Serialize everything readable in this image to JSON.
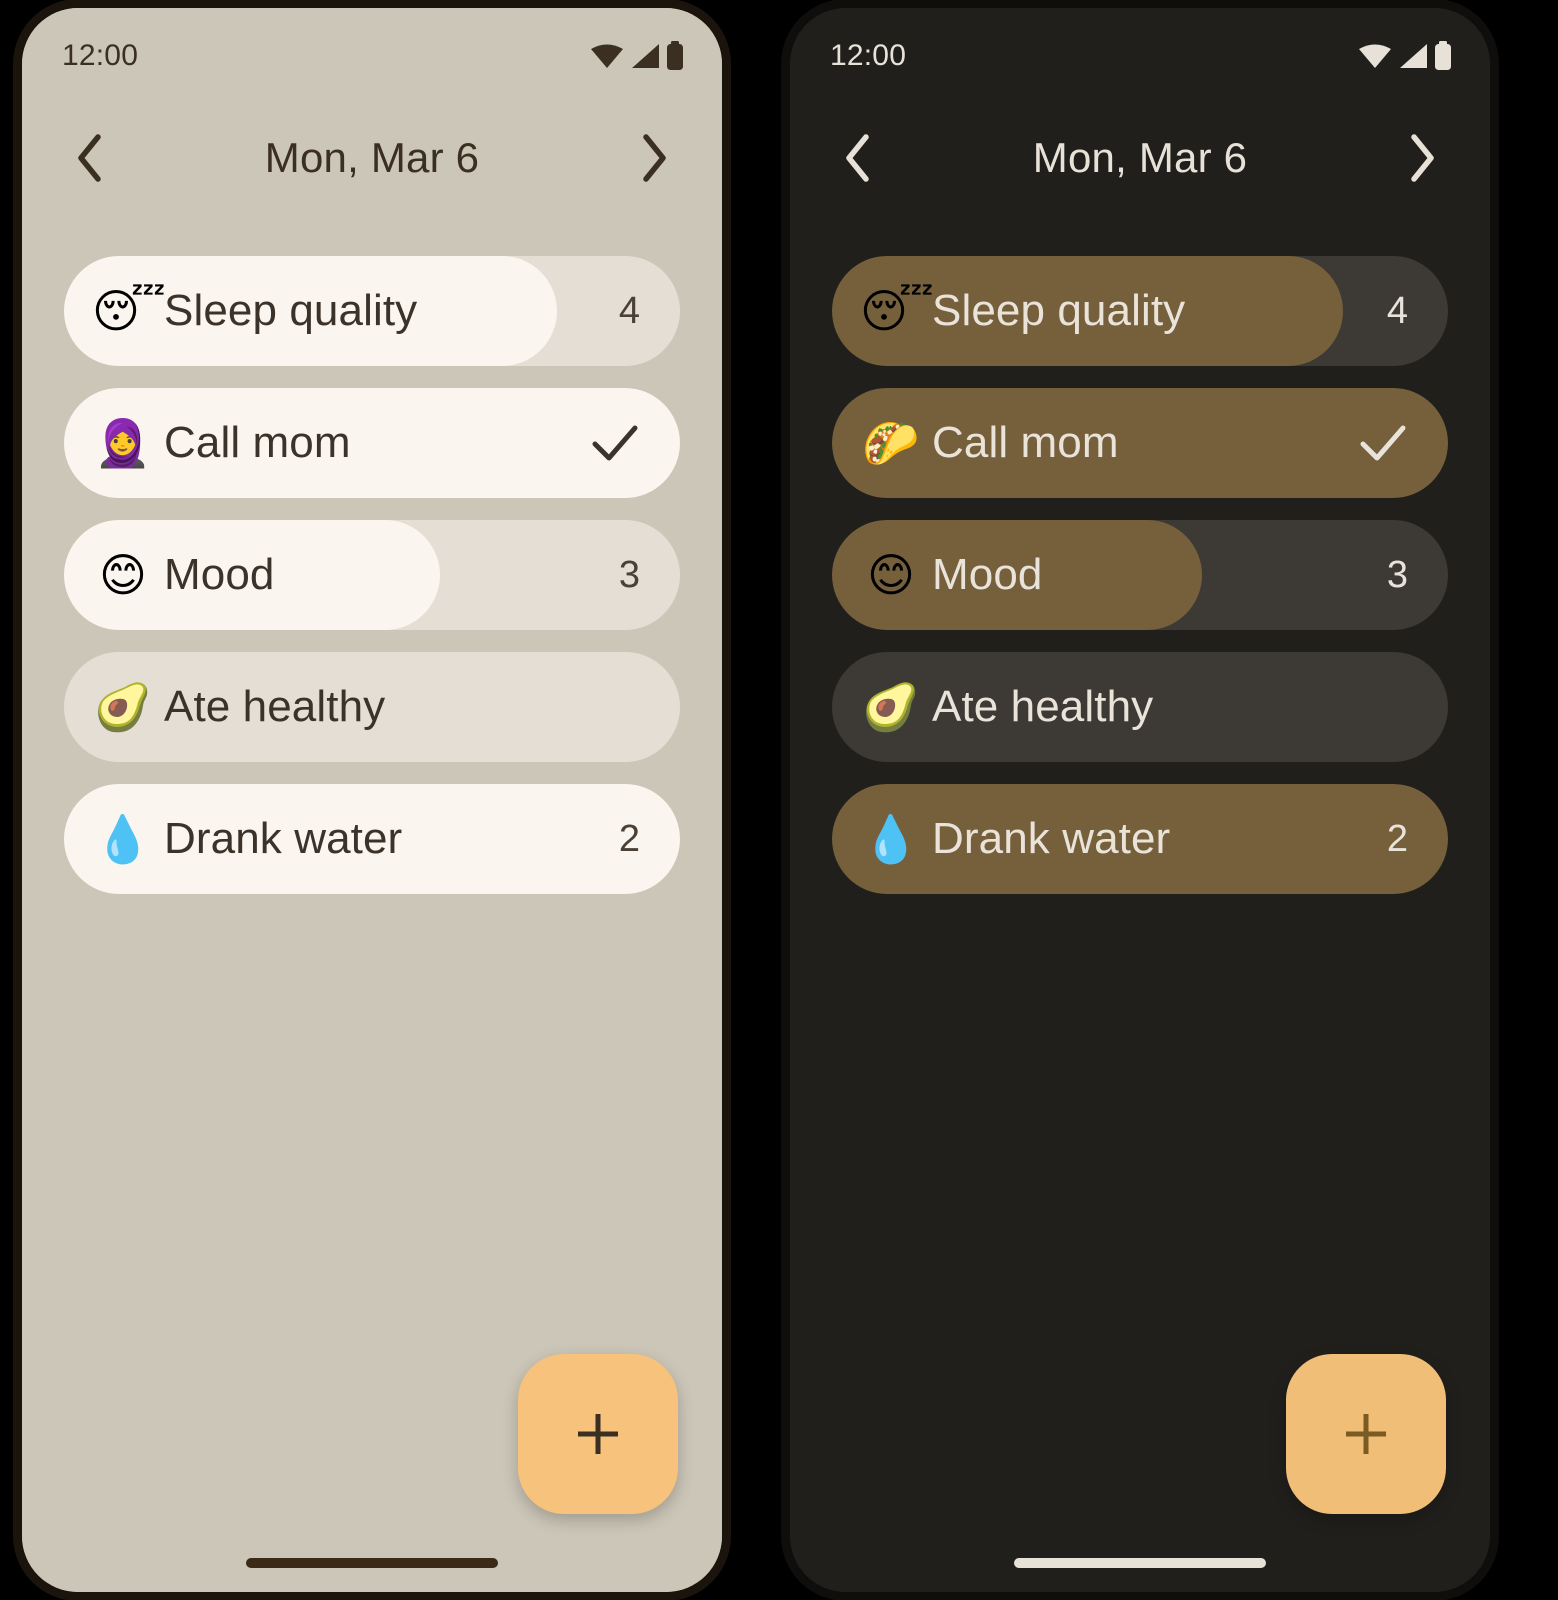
{
  "screens": [
    {
      "theme": "light",
      "name": "light-theme-phone",
      "status": {
        "time": "12:00",
        "icons": [
          "wifi-icon",
          "cellular-signal-icon",
          "battery-icon"
        ]
      },
      "nav": {
        "prev_label": "‹",
        "prev_name": "previous-day-button",
        "title": "Mon, Mar 6",
        "next_label": "›",
        "next_name": "next-day-button"
      },
      "habits": [
        {
          "emoji": "😴",
          "emoji_name": "sleeping-face-emoji",
          "label": "Sleep quality",
          "value": "4",
          "type": "counter",
          "fill_pct": 80
        },
        {
          "emoji": "🧕",
          "emoji_name": "woman-with-headscarf-emoji",
          "label": "Call mom",
          "value": "",
          "type": "check",
          "fill_pct": 100
        },
        {
          "emoji": "😊",
          "emoji_name": "smiling-face-emoji",
          "label": "Mood",
          "value": "3",
          "type": "counter",
          "fill_pct": 61
        },
        {
          "emoji": "🥑",
          "emoji_name": "avocado-emoji",
          "label": "Ate healthy",
          "value": "",
          "type": "none",
          "fill_pct": 0
        },
        {
          "emoji": "💧",
          "emoji_name": "droplet-emoji",
          "label": "Drank water",
          "value": "2",
          "type": "counter",
          "fill_pct": 100
        }
      ],
      "fab": {
        "label": "+",
        "name": "add-habit-button"
      },
      "colors": {
        "background": "#CCC6B8",
        "track": "#E5DED4",
        "fill": "#FAF5EF",
        "text": "#3B332A",
        "accent": "#F6C27C"
      }
    },
    {
      "theme": "dark",
      "name": "dark-theme-phone",
      "status": {
        "time": "12:00",
        "icons": [
          "wifi-icon",
          "cellular-signal-icon",
          "battery-icon"
        ]
      },
      "nav": {
        "prev_label": "‹",
        "prev_name": "previous-day-button",
        "title": "Mon, Mar 6",
        "next_label": "›",
        "next_name": "next-day-button"
      },
      "habits": [
        {
          "emoji": "😴",
          "emoji_name": "sleeping-face-emoji",
          "label": "Sleep quality",
          "value": "4",
          "type": "counter",
          "fill_pct": 83
        },
        {
          "emoji": "🌮",
          "emoji_name": "taco-emoji",
          "label": "Call mom",
          "value": "",
          "type": "check",
          "fill_pct": 100
        },
        {
          "emoji": "😊",
          "emoji_name": "smiling-face-emoji",
          "label": "Mood",
          "value": "3",
          "type": "counter",
          "fill_pct": 60
        },
        {
          "emoji": "🥑",
          "emoji_name": "avocado-emoji",
          "label": "Ate healthy",
          "value": "",
          "type": "none",
          "fill_pct": 0
        },
        {
          "emoji": "💧",
          "emoji_name": "droplet-emoji",
          "label": "Drank water",
          "value": "2",
          "type": "counter",
          "fill_pct": 100
        }
      ],
      "fab": {
        "label": "+",
        "name": "add-habit-button"
      },
      "colors": {
        "background": "#211F1C",
        "track": "#3D3A35",
        "fill": "#76603C",
        "text": "#E9E3DA",
        "accent": "#F0BE76"
      }
    }
  ]
}
